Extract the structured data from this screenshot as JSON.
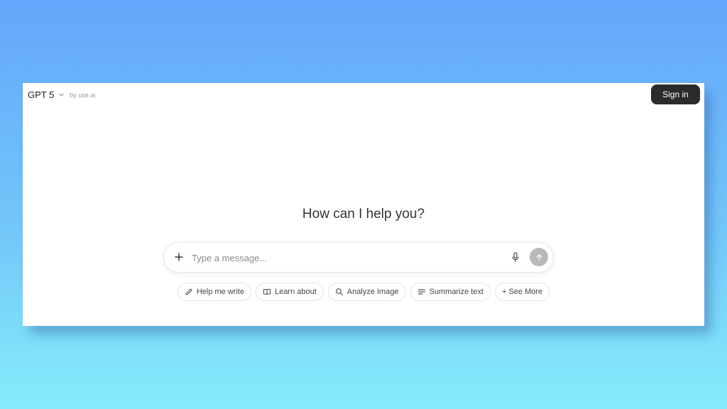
{
  "header": {
    "model_name": "GPT 5",
    "byline": "by use.ai",
    "signin_label": "Sign in"
  },
  "main": {
    "headline": "How can I help you?"
  },
  "composer": {
    "placeholder": "Type a message...",
    "value": ""
  },
  "chips": [
    {
      "label": "Help me write",
      "icon": "pencil-icon"
    },
    {
      "label": "Learn about",
      "icon": "book-icon"
    },
    {
      "label": "Analyze Image",
      "icon": "search-icon"
    },
    {
      "label": "Summarize text",
      "icon": "lines-icon"
    },
    {
      "label": "+ See More",
      "icon": ""
    }
  ],
  "colors": {
    "signin_bg": "#2b2b2b",
    "send_button_bg": "#b8b8b8",
    "background_top": "#64a6fb",
    "background_bottom": "#86ecfb"
  }
}
